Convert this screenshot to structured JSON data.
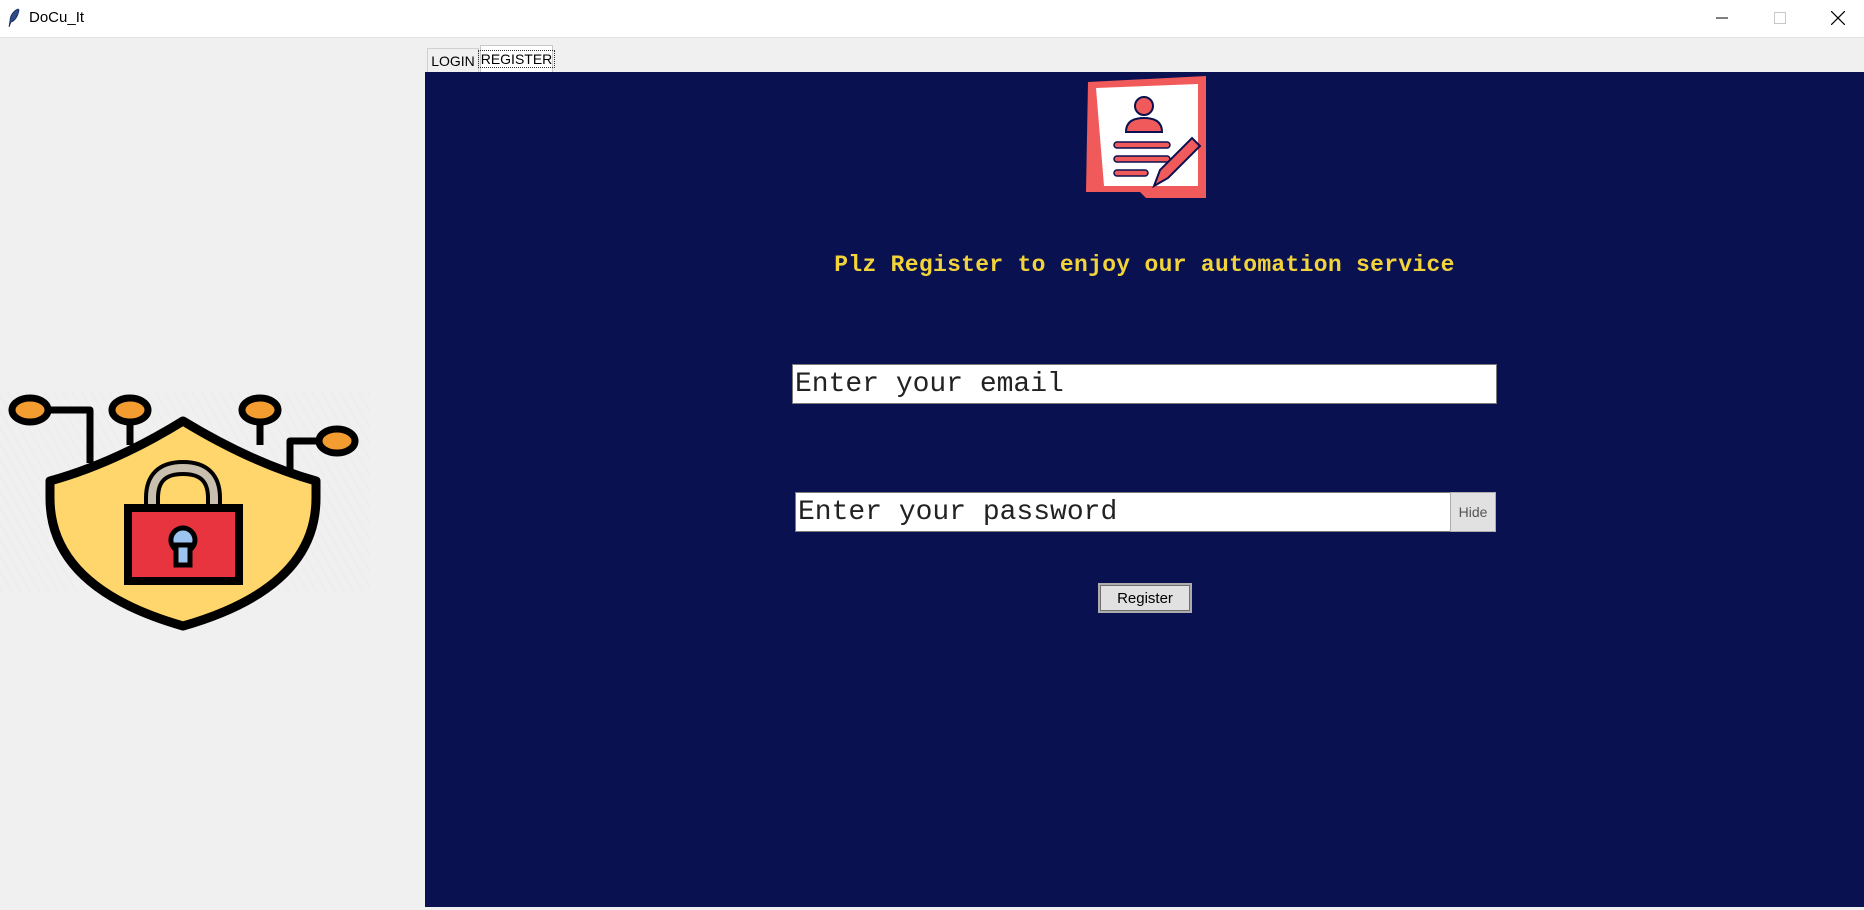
{
  "window": {
    "title": "DoCu_It",
    "icon": "feather-icon",
    "controls": [
      "minimize-icon",
      "maximize-icon",
      "close-icon"
    ]
  },
  "tabs": [
    {
      "label": "LOGIN",
      "selected": false
    },
    {
      "label": "REGISTER",
      "selected": true
    }
  ],
  "left_panel": {
    "image": "shield-lock-icon"
  },
  "register_form": {
    "image": "register-document-icon",
    "headline": "Plz Register to enjoy our automation service",
    "email_placeholder": "Enter your email",
    "password_placeholder": "Enter your password",
    "hide_label": "Hide",
    "submit_label": "Register"
  },
  "colors": {
    "panel_background": "#0a1151",
    "headline": "#f2d43a",
    "accent_red": "#f05a5a",
    "shield_yellow": "#ffd66b",
    "lock_red": "#e8343f",
    "node_orange": "#f39c2f"
  }
}
